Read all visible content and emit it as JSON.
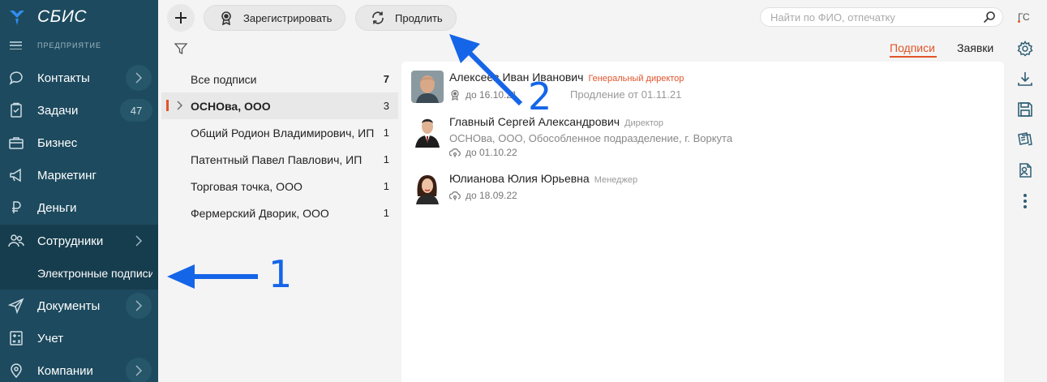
{
  "app": {
    "logo_text": "СБИС",
    "company_label": "ПРЕДПРИЯТИЕ"
  },
  "sidebar": {
    "items": [
      {
        "label": "Контакты",
        "has_chevron": true
      },
      {
        "label": "Задачи",
        "count": "47"
      },
      {
        "label": "Бизнес"
      },
      {
        "label": "Маркетинг"
      },
      {
        "label": "Деньги"
      },
      {
        "label": "Сотрудники",
        "has_chevron": true
      },
      {
        "label": "Документы",
        "has_chevron": true
      },
      {
        "label": "Учет"
      },
      {
        "label": "Компании",
        "has_chevron": true
      }
    ],
    "subitem": "Электронные подписи"
  },
  "toolbar": {
    "register_label": "Зарегистрировать",
    "renew_label": "Продлить",
    "search_placeholder": "Найти по ФИО, отпечатку"
  },
  "user": {
    "initials": "ГС"
  },
  "orgs": [
    {
      "name": "Все подписи",
      "count": "7"
    },
    {
      "name": "ОСНОва, ООО",
      "count": "3"
    },
    {
      "name": "Общий Родион Владимирович, ИП",
      "count": "1"
    },
    {
      "name": "Патентный Павел Павлович, ИП",
      "count": "1"
    },
    {
      "name": "Торговая точка, ООО",
      "count": "1"
    },
    {
      "name": "Фермерский Дворик, ООО",
      "count": "1"
    }
  ],
  "tabs": {
    "signatures": "Подписи",
    "requests": "Заявки"
  },
  "people": [
    {
      "name": "Алексеев Иван Иванович",
      "role": "Генеральный директор",
      "role_color": "#e2542a",
      "expiry": "до 16.10.21",
      "renewal": "Продление от 01.11.21"
    },
    {
      "name": "Главный Сергей Александрович",
      "role": "Директор",
      "role_color": "#999999",
      "org": "ОСНОва, ООО, Обособленное подразделение, г. Воркута",
      "expiry": "до 01.10.22"
    },
    {
      "name": "Юлианова Юлия Юрьевна",
      "role": "Менеджер",
      "role_color": "#999999",
      "expiry": "до 18.09.22"
    }
  ],
  "annotations": {
    "one": "1",
    "two": "2"
  },
  "colors": {
    "sidebar": "#1d4a5e",
    "accent": "#e2542a",
    "annotation": "#1565e8"
  }
}
